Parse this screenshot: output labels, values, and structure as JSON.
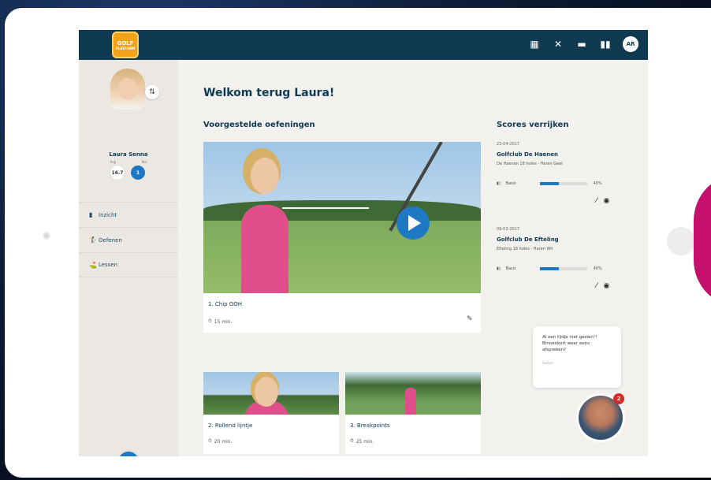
{
  "app": {
    "logo": {
      "line1": "GOLF",
      "line2": "PLATFORM"
    },
    "avatar_initials": "AR",
    "nav_icons": [
      "grid-icon",
      "tools-icon",
      "folder-icon",
      "chart-icon"
    ]
  },
  "profile": {
    "name": "Laura Senna",
    "label_hcp": "hcp",
    "label_rank": "Rol",
    "hcp_value": "16.7",
    "rank_value": "1"
  },
  "sidebar": {
    "items": [
      {
        "icon": "chart-icon",
        "label": "Inzicht"
      },
      {
        "icon": "golf-tee-icon",
        "label": "Oefenen"
      },
      {
        "icon": "lesson-icon",
        "label": "Lessen"
      }
    ],
    "fab_label": "+"
  },
  "main": {
    "welcome": "Welkom terug Laura!",
    "exercises_title": "Voorgestelde oefeningen",
    "featured": {
      "title": "1. Chip GOH",
      "duration": "15 min."
    },
    "cards": [
      {
        "title": "2. Rollend lijntje",
        "duration": "20 min."
      },
      {
        "title": "3. Breakpoints",
        "duration": "25 min."
      }
    ]
  },
  "scores": {
    "title": "Scores verrijken",
    "entries": [
      {
        "date": "23-04-2017",
        "club": "Golfclub De Haenen",
        "course": "De Haenen 18 holes - Heren Geel",
        "label": "Basis",
        "percent_label": "40%",
        "progress": 0.4
      },
      {
        "date": "09-03-2017",
        "club": "Golfclub De Efteling",
        "course": "Efteling 18 holes - Heren Wit",
        "label": "Basis",
        "percent_label": "40%",
        "progress": 0.4
      }
    ]
  },
  "chat": {
    "message": "Al een tijdje niet gezien!! Binnenkort weer eens afspreken?",
    "dismiss": "Sluiten",
    "badge": "2"
  },
  "colors": {
    "topbar": "#0f3a52",
    "accent": "#1f79c2",
    "brand_pink": "#c4106c"
  }
}
